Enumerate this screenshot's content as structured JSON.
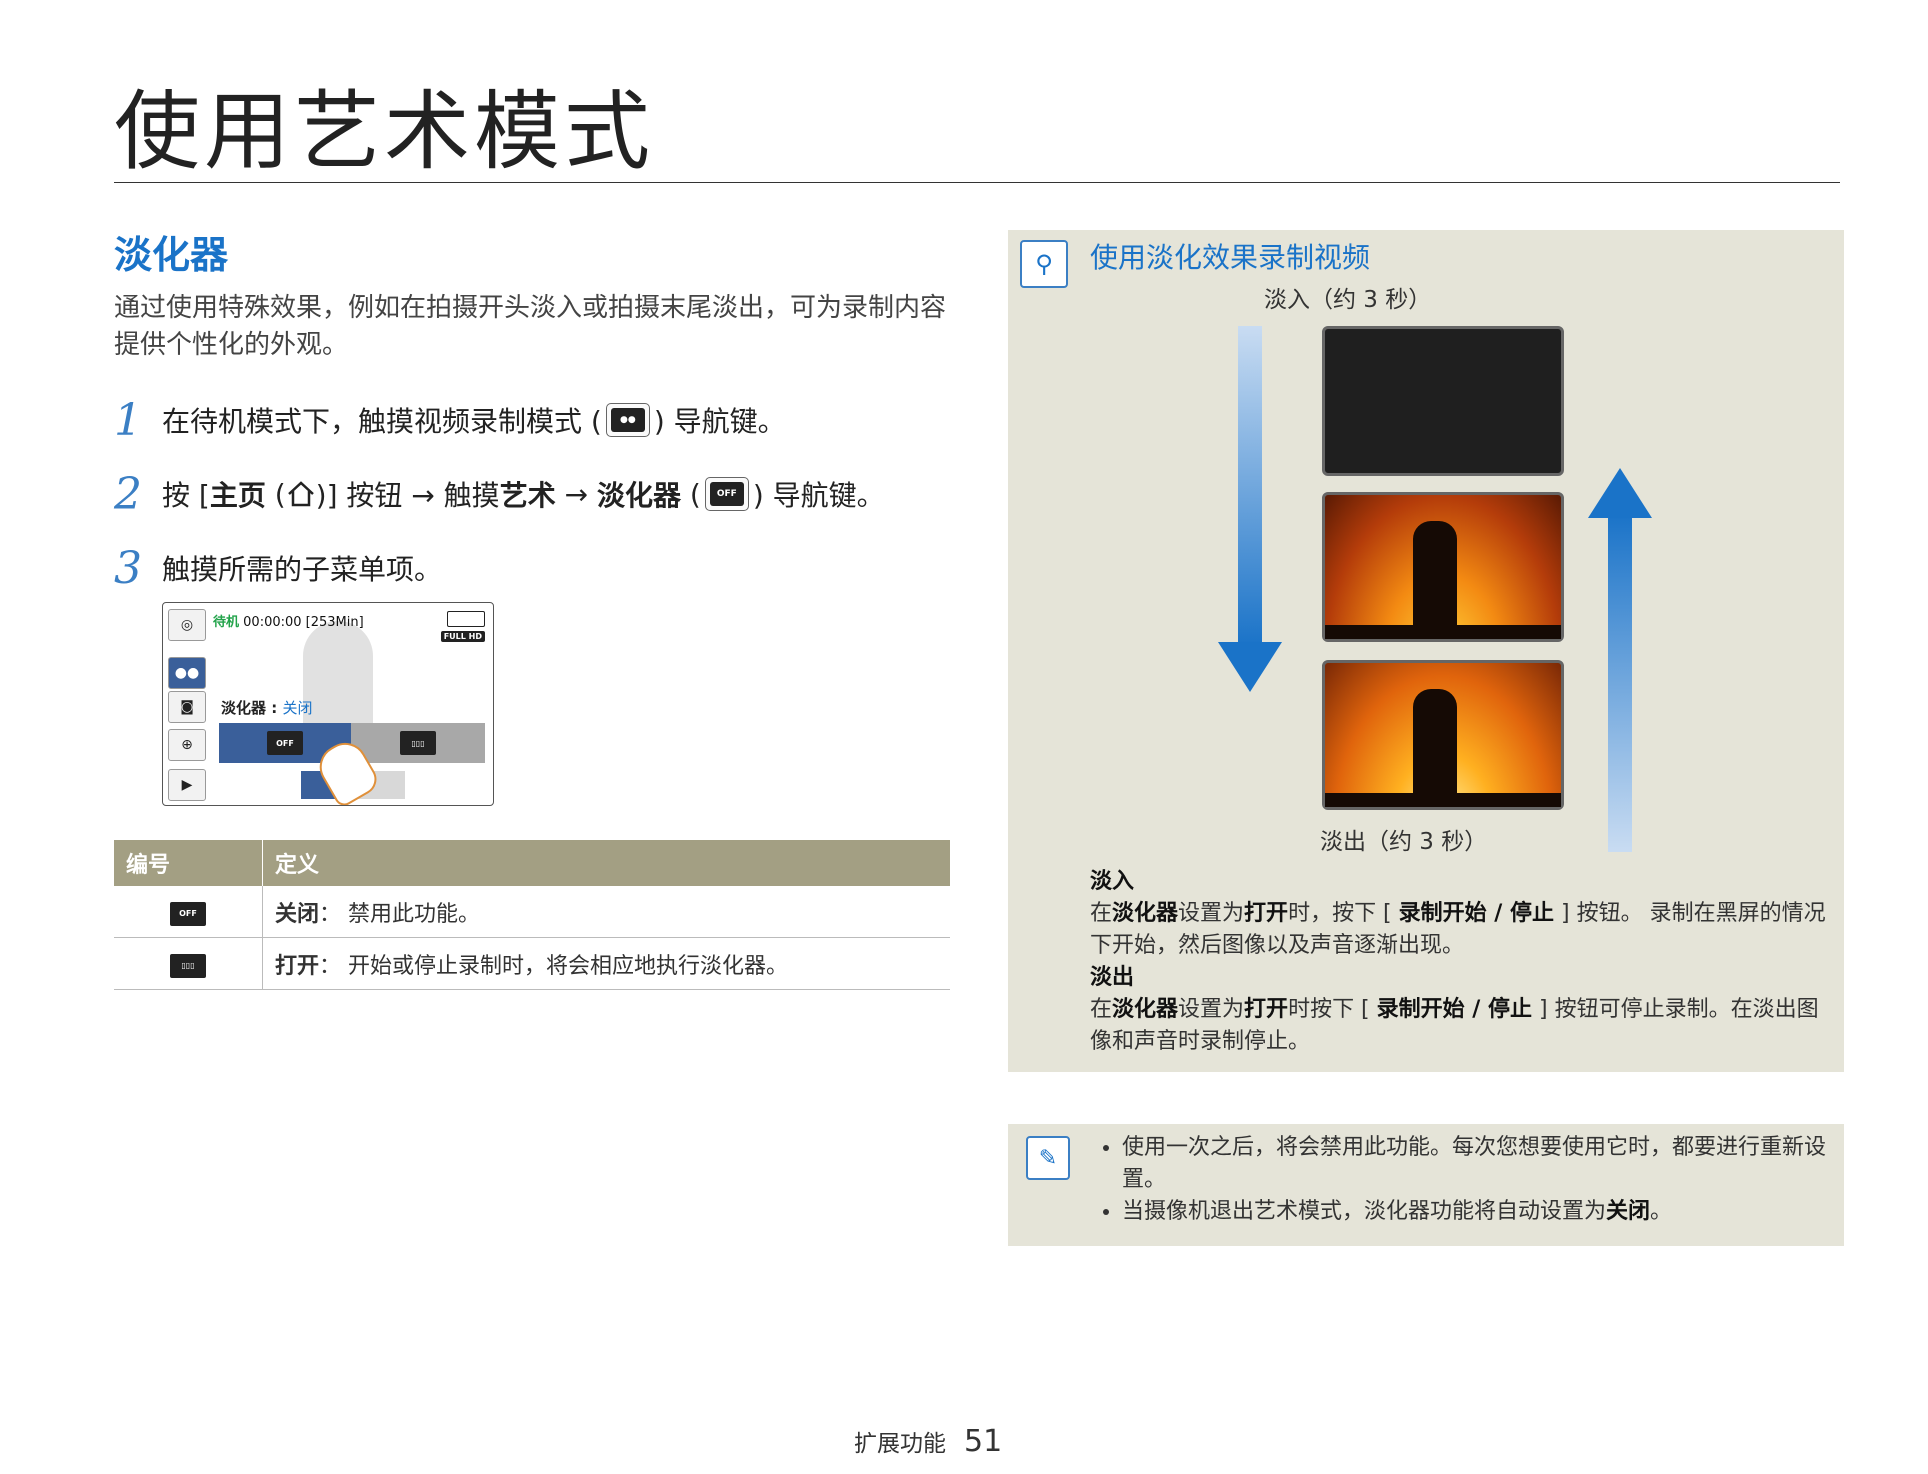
{
  "page": {
    "title": "使用艺术模式",
    "section_title": "淡化器",
    "intro": "通过使用特殊效果，例如在拍摄开头淡入或拍摄末尾淡出，可为录制内容提供个性化的外观。"
  },
  "steps": [
    {
      "num": "1",
      "pre": "在待机模式下，触摸视频录制模式 (",
      "post": ") 导航键。"
    },
    {
      "num": "2",
      "pre": "按 [ ",
      "home": "主页",
      "mid": ")] 按钮 → 触摸",
      "art": "艺术",
      "arrow": " → ",
      "fader": "淡化器",
      "post": ") 导航键。"
    },
    {
      "num": "3",
      "text": "触摸所需的子菜单项。"
    }
  ],
  "screen": {
    "status_label": "待机",
    "time": "00:00:00 [253Min]",
    "fader_label": "淡化器 : ",
    "fader_value": "关闭",
    "off_icon_text": "OFF",
    "hd_badge": "FULL HD"
  },
  "table": {
    "headers": [
      "编号",
      "定义"
    ],
    "rows": [
      {
        "icon": "fader-off-icon",
        "icon_text": "OFF",
        "term": "关闭",
        "desc": "： 禁用此功能。"
      },
      {
        "icon": "fader-on-icon",
        "icon_text": "ON",
        "term": "打开",
        "desc": "： 开始或停止录制时，将会相应地执行淡化器。"
      }
    ]
  },
  "panel": {
    "title": "使用淡化效果录制视频",
    "fadein_caption": "淡入（约 3 秒）",
    "fadeout_caption": "淡出（约 3 秒）",
    "fadein_heading": "淡入",
    "fadein_text": {
      "a": "在",
      "b": "淡化器",
      "c": "设置为",
      "d": "打开",
      "e": "时，按下 [ ",
      "f": "录制开始 / 停止",
      "g": " ] 按钮。 录制在黑屏的情况下开始，然后图像以及声音逐渐出现。"
    },
    "fadeout_heading": "淡出",
    "fadeout_text": {
      "a": "在",
      "b": "淡化器",
      "c": "设置为",
      "d": "打开",
      "e": "时按下 [ ",
      "f": "录制开始 / 停止",
      "g": " ] 按钮可停止录制。在淡出图像和声音时录制停止。"
    },
    "arrow_color": "#1a73c8"
  },
  "note": {
    "items": [
      {
        "text": "使用一次之后，将会禁用此功能。每次您想要使用它时，都要进行重新设置。"
      },
      {
        "pre": "当摄像机退出艺术模式，淡化器功能将自动设置为",
        "bold": "关闭",
        "post": "。"
      }
    ]
  },
  "footer": {
    "section": "扩展功能",
    "page_num": "51"
  }
}
